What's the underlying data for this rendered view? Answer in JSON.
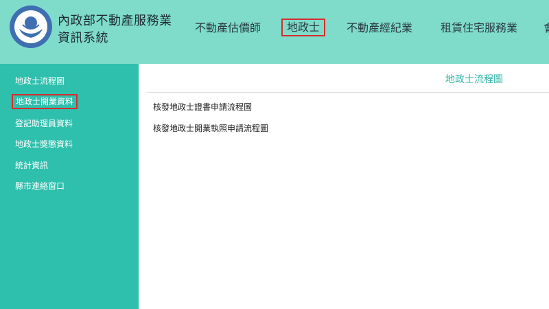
{
  "header": {
    "site_title": "內政部不動產服務業資訊系統",
    "nav_items": [
      {
        "label": "不動產估價師"
      },
      {
        "label": "地政士"
      },
      {
        "label": "不動產經紀業"
      },
      {
        "label": "租賃住宅服務業"
      },
      {
        "label": "會"
      }
    ]
  },
  "sidebar": {
    "items": [
      {
        "label": "地政士流程圖"
      },
      {
        "label": "地政士開業資料"
      },
      {
        "label": "登記助理員資料"
      },
      {
        "label": "地政士獎懲資料"
      },
      {
        "label": "統計資訊"
      },
      {
        "label": "縣市連絡窗口"
      }
    ]
  },
  "content": {
    "title": "地政士流程圖",
    "links": [
      {
        "label": "核發地政士證書申請流程圖"
      },
      {
        "label": "核發地政士開業執照申請流程圖"
      }
    ]
  },
  "colors": {
    "header_bg": "#7fdccb",
    "sidebar_bg": "#2fbfad",
    "accent": "#2fb3a6",
    "highlight_box": "#d62b2b"
  }
}
